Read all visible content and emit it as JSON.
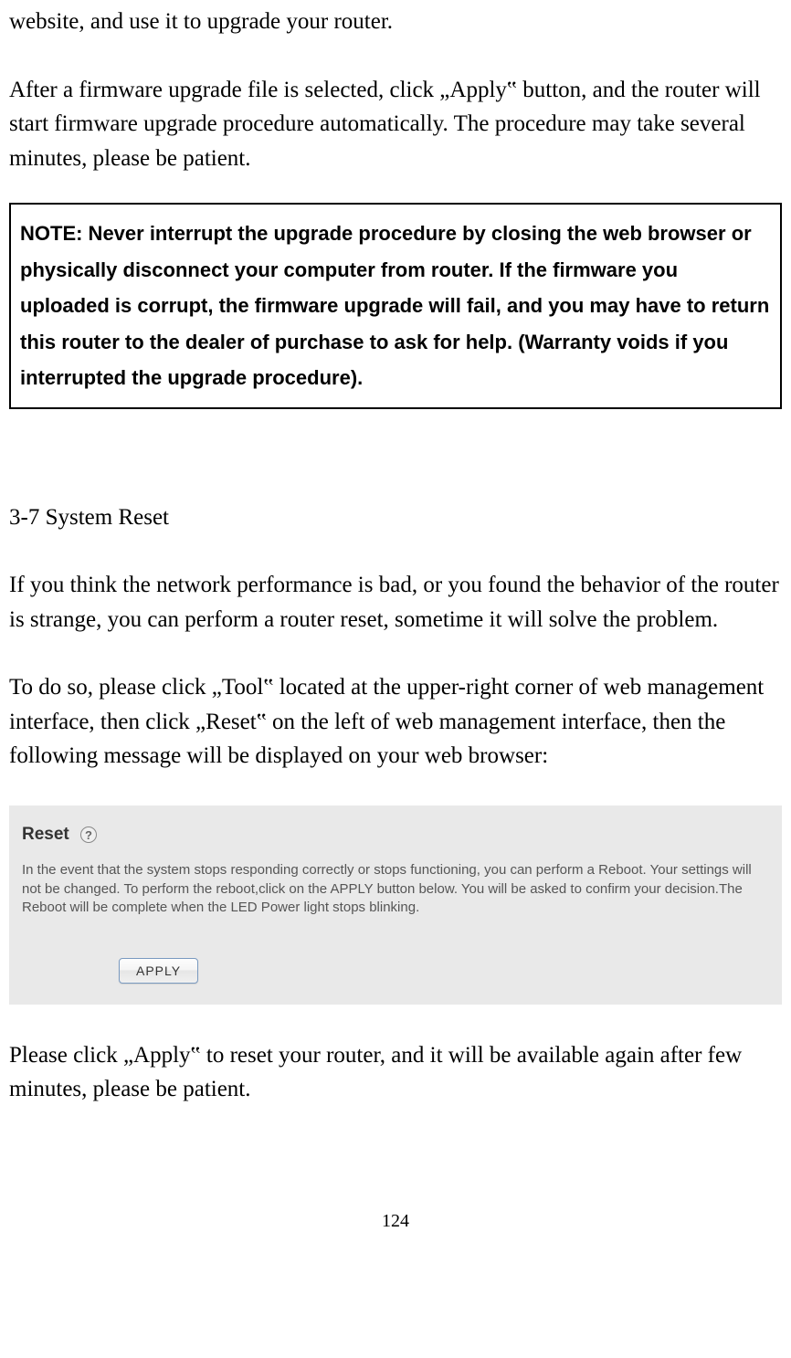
{
  "para1": "website, and use it to upgrade your router.",
  "para2": "After a firmware upgrade file is selected, click „Apply‟ button, and the router will start firmware upgrade procedure automatically. The procedure may take several minutes, please be patient.",
  "note": "NOTE: Never interrupt the upgrade procedure by closing the web browser or physically disconnect your computer from router. If the firmware you uploaded is corrupt, the firmware upgrade will fail, and you may have to return this router to the dealer of purchase to ask for help. (Warranty voids if you interrupted the upgrade procedure).",
  "section_title": "3-7 System Reset",
  "para3": "If you think the network performance is bad, or you found the behavior of the router is strange, you can perform a router reset, sometime it will solve the problem.",
  "para4": "To do so, please click „Tool‟ located at the upper-right corner of web management interface, then click „Reset‟ on the left of web management interface, then the following message will be displayed on your web browser:",
  "screenshot": {
    "title": "Reset",
    "help": "?",
    "desc": "In the event that the system stops responding correctly or stops functioning, you can perform a Reboot. Your settings will not be changed. To perform the reboot,click on the APPLY button below. You will be asked to confirm your decision.The Reboot will be complete when the LED Power light stops blinking.",
    "button": "APPLY"
  },
  "para5": "Please click „Apply‟ to reset your router, and it will be available again after few minutes, please be patient.",
  "page_number": "124"
}
